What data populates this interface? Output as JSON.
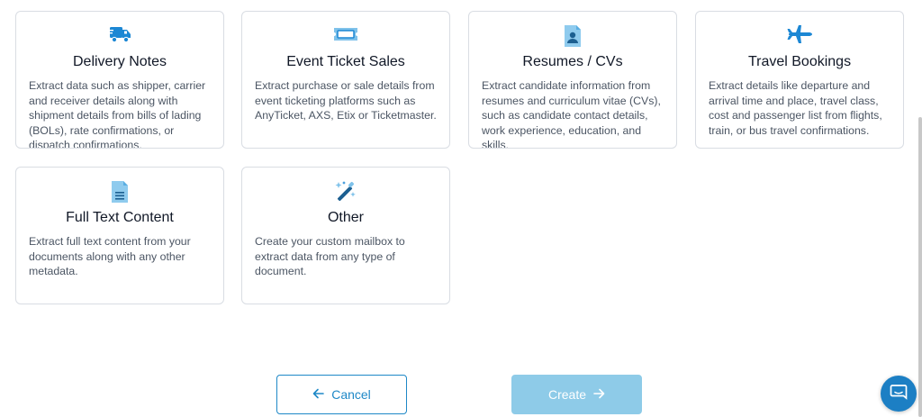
{
  "colors": {
    "accent": "#1e88c7",
    "icon_blue": "#1c87d4",
    "create_disabled": "#8ecbe8",
    "chat": "#1c7fc4"
  },
  "cards": [
    {
      "icon": "delivery-truck-icon",
      "title": "Delivery Notes",
      "desc": "Extract data such as shipper, carrier and receiver details along with shipment details from bills of lading (BOLs), rate confirmations, or dispatch confirmations."
    },
    {
      "icon": "ticket-icon",
      "title": "Event Ticket Sales",
      "desc": "Extract purchase or sale details from event ticketing platforms such as AnyTicket, AXS, Etix or Ticketmaster."
    },
    {
      "icon": "resume-id-icon",
      "title": "Resumes / CVs",
      "desc": "Extract candidate information from resumes and curriculum vitae (CVs), such as candidate contact details, work experience, education, and skills."
    },
    {
      "icon": "airplane-icon",
      "title": "Travel Bookings",
      "desc": "Extract details like departure and arrival time and place, travel class, cost and passenger list from flights, train, or bus travel confirmations."
    },
    {
      "icon": "document-text-icon",
      "title": "Full Text Content",
      "desc": "Extract full text content from your documents along with any other metadata."
    },
    {
      "icon": "magic-wand-icon",
      "title": "Other",
      "desc": "Create your custom mailbox to extract data from any type of document."
    }
  ],
  "buttons": {
    "cancel_label": "Cancel",
    "create_label": "Create"
  }
}
